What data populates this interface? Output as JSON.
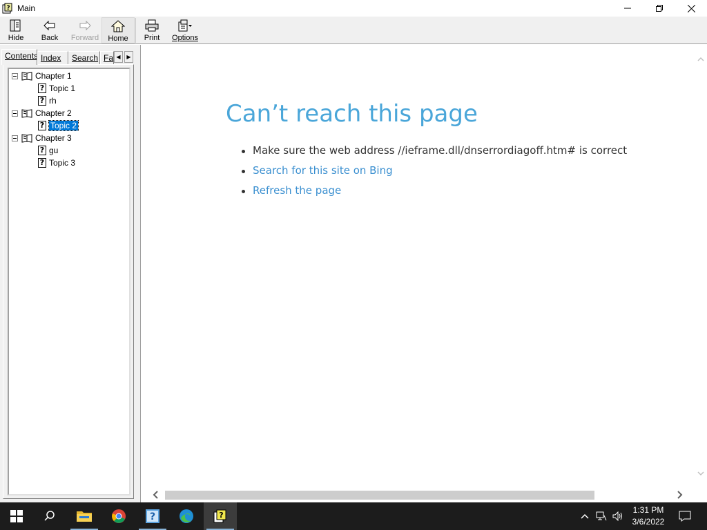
{
  "window": {
    "title": "Main"
  },
  "toolbar": {
    "hide_label": "Hide",
    "back_label": "Back",
    "forward_label": "Forward",
    "home_label": "Home",
    "print_label": "Print",
    "options_label": "Options"
  },
  "tabs": [
    {
      "label": "Contents",
      "active": true
    },
    {
      "label": "Index"
    },
    {
      "label": "Search"
    },
    {
      "label": "Fa"
    }
  ],
  "tree": {
    "chapters": [
      {
        "label": "Chapter 1",
        "topics": [
          "Topic 1",
          "rh"
        ]
      },
      {
        "label": "Chapter 2",
        "topics": [
          "Topic 2"
        ]
      },
      {
        "label": "Chapter 3",
        "topics": [
          "gu",
          "Topic 3"
        ]
      }
    ],
    "selected": "Topic 2"
  },
  "content": {
    "heading": "Can’t reach this page",
    "bullets": [
      "Make sure the web address //ieframe.dll/dnserrordiagoff.htm# is correct",
      "Search for this site on Bing",
      "Refresh the page"
    ]
  },
  "taskbar": {
    "time": "1:31 PM",
    "date": "3/6/2022",
    "apps": [
      "start",
      "search",
      "file-explorer",
      "chrome",
      "help-viewer",
      "edge",
      "help-workshop"
    ]
  },
  "colors": {
    "heading": "#4aa6d9",
    "link": "#3a8fd0",
    "selection": "#0078d7",
    "taskbar": "#1c1c1c"
  }
}
